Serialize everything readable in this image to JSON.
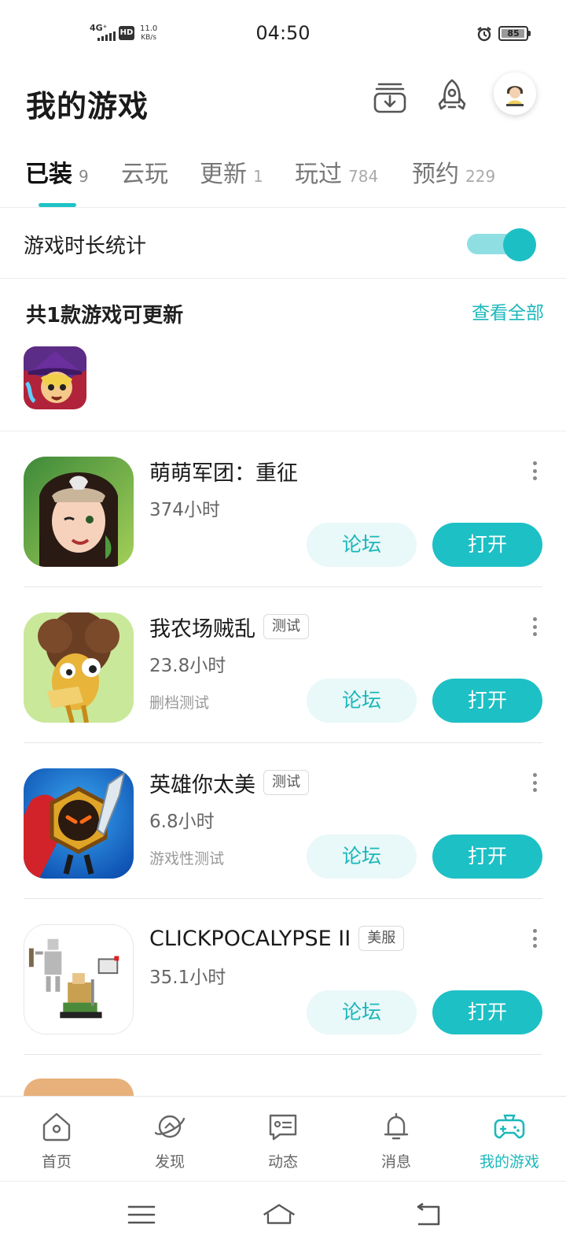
{
  "status_bar": {
    "network": "4G⁺",
    "hd": "HD",
    "speed_value": "11.0",
    "speed_unit": "KB/s",
    "time": "04:50",
    "battery": "85"
  },
  "header": {
    "title": "我的游戏",
    "icons": [
      "download-icon",
      "rocket-icon",
      "user-avatar"
    ]
  },
  "tabs": [
    {
      "label": "已装",
      "count": "9",
      "active": true
    },
    {
      "label": "云玩",
      "count": "",
      "active": false
    },
    {
      "label": "更新",
      "count": "1",
      "active": false
    },
    {
      "label": "玩过",
      "count": "784",
      "active": false
    },
    {
      "label": "预约",
      "count": "229",
      "active": false
    }
  ],
  "stats": {
    "label": "游戏时长统计",
    "enabled": true
  },
  "updates": {
    "title": "共1款游戏可更新",
    "see_all": "查看全部"
  },
  "games": [
    {
      "name": "萌萌军团：重征",
      "badge": "",
      "hours": "374小时",
      "note": "",
      "forum": "论坛",
      "open": "打开"
    },
    {
      "name": "我农场贼乱",
      "badge": "测试",
      "hours": "23.8小时",
      "note": "删档测试",
      "forum": "论坛",
      "open": "打开"
    },
    {
      "name": "英雄你太美",
      "badge": "测试",
      "hours": "6.8小时",
      "note": "游戏性测试",
      "forum": "论坛",
      "open": "打开"
    },
    {
      "name": "CLICKPOCALYPSE II",
      "badge": "美服",
      "hours": "35.1小时",
      "note": "",
      "forum": "论坛",
      "open": "打开"
    }
  ],
  "bottom_nav": [
    {
      "label": "首页",
      "icon": "home-icon",
      "active": false
    },
    {
      "label": "发现",
      "icon": "planet-icon",
      "active": false
    },
    {
      "label": "动态",
      "icon": "chat-card-icon",
      "active": false
    },
    {
      "label": "消息",
      "icon": "bell-icon",
      "active": false
    },
    {
      "label": "我的游戏",
      "icon": "gamepad-icon",
      "active": true
    }
  ],
  "colors": {
    "accent": "#1dc0c5",
    "accent_light": "#e9f8f8",
    "text": "#1a1a1a"
  }
}
